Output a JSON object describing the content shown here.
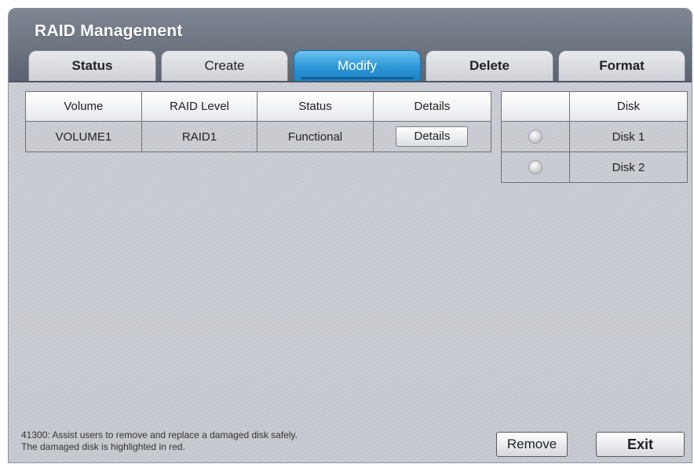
{
  "window": {
    "title": "RAID Management"
  },
  "tabs": [
    {
      "label": "Status",
      "active": false
    },
    {
      "label": "Create",
      "active": false
    },
    {
      "label": "Modify",
      "active": true
    },
    {
      "label": "Delete",
      "active": false
    },
    {
      "label": "Format",
      "active": false
    }
  ],
  "volume_table": {
    "headers": [
      "Volume",
      "RAID Level",
      "Status",
      "Details"
    ],
    "rows": [
      {
        "volume": "VOLUME1",
        "raid_level": "RAID1",
        "status": "Functional",
        "details_button": "Details"
      }
    ]
  },
  "disk_table": {
    "headers": [
      "",
      "Disk"
    ],
    "rows": [
      {
        "disk": "Disk 1",
        "selected": false
      },
      {
        "disk": "Disk 2",
        "selected": false
      }
    ]
  },
  "footer": {
    "note_line1": "41300: Assist users to remove and replace a damaged disk safely.",
    "note_line2": "The damaged disk is highlighted in red.",
    "remove_label": "Remove",
    "exit_label": "Exit"
  },
  "colors": {
    "active_tab": "#2a95d6",
    "title_bar": "#6c7480"
  }
}
